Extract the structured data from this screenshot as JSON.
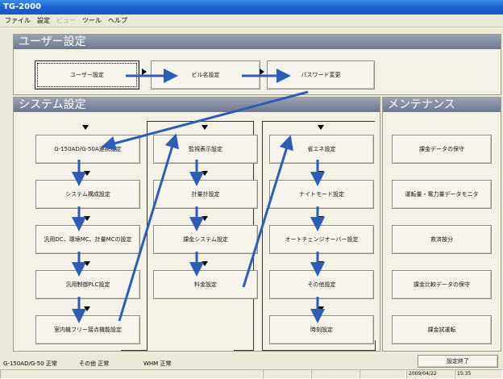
{
  "window": {
    "title": "TG-2000"
  },
  "menu": [
    {
      "label": "ファイル",
      "disabled": false
    },
    {
      "label": "設定",
      "disabled": false
    },
    {
      "label": "ビュー",
      "disabled": true
    },
    {
      "label": "ツール",
      "disabled": false
    },
    {
      "label": "ヘルプ",
      "disabled": false
    }
  ],
  "user_section": {
    "title": "ユーザー設定",
    "buttons": [
      "ユーザー設定",
      "ビル名設定",
      "パスワード変更"
    ]
  },
  "system_section": {
    "title": "システム設定",
    "col1": [
      "G-150AD/G-50A連携設定",
      "システム構成設定",
      "汎用DC、環境MC、計量MCの設定",
      "汎用制御PLC設定",
      "室内機フリー接点機能設定"
    ],
    "col2": [
      "監視表示設定",
      "計量計設定",
      "課金システム設定",
      "料金設定"
    ],
    "col3": [
      "省エネ設定",
      "ナイトモード設定",
      "オートチェンジオーバー設定",
      "その他設定",
      "時刻設定"
    ]
  },
  "maintenance_section": {
    "title": "メンテナンス",
    "buttons": [
      "課金データの保守",
      "運転量・電力量データモニタ",
      "救済按分",
      "課金比較データの保守",
      "課金試運転"
    ]
  },
  "status": {
    "g150": "G-150AD/G-50  正常",
    "other": "その他  正常",
    "whm": "WHM  正常",
    "end_button": "設定終了",
    "date": "2009/04/22",
    "time": "15:35"
  },
  "colors": {
    "accent_arrow": "#2f5db5",
    "title_bar": "#1c5fd0",
    "panel_header": "#7a8498"
  }
}
